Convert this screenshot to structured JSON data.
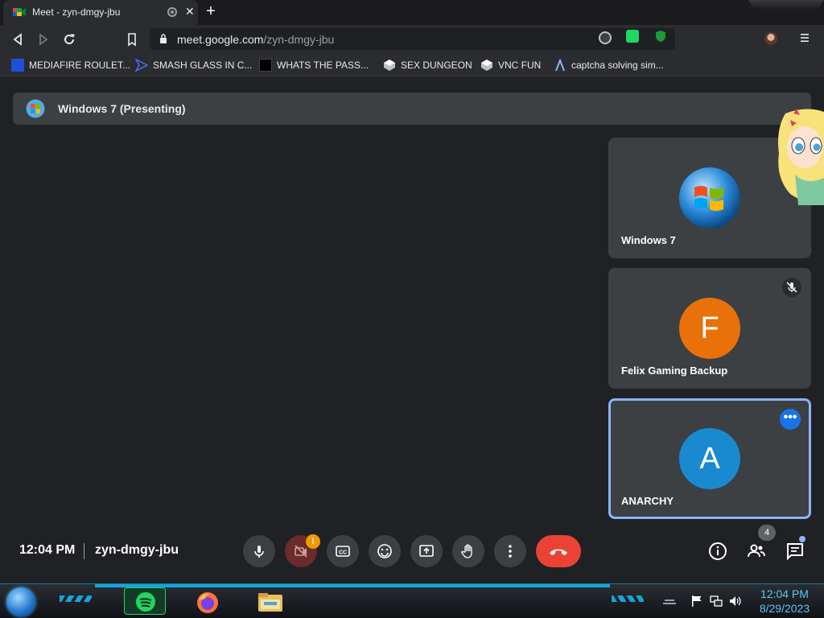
{
  "browser": {
    "tab": {
      "title": "Meet - zyn-dmgy-jbu"
    },
    "url": {
      "host": "meet.google.com",
      "path": "/zyn-dmgy-jbu"
    }
  },
  "bookmarks": [
    {
      "label": "MEDIAFIRE ROULET..."
    },
    {
      "label": "SMASH GLASS IN C..."
    },
    {
      "label": "WHATS THE PASS..."
    },
    {
      "label": "SEX DUNGEON"
    },
    {
      "label": "VNC FUN"
    },
    {
      "label": "captcha solving sim..."
    }
  ],
  "meet": {
    "presenting_label": "Windows 7 (Presenting)",
    "participants": [
      {
        "name": "Windows 7"
      },
      {
        "name": "Felix Gaming Backup",
        "initial": "F",
        "color": "#e8710a"
      },
      {
        "name": "ANARCHY",
        "initial": "A",
        "color": "#1a8ad0"
      }
    ],
    "footer": {
      "time": "12:04 PM",
      "meeting_code": "zyn-dmgy-jbu",
      "camera_warning": "!",
      "participant_count": "4"
    }
  },
  "taskbar": {
    "time": "12:04 PM",
    "date": "8/29/2023"
  },
  "colors": {
    "leave": "#ea4335",
    "accent": "#8ab4f8"
  }
}
